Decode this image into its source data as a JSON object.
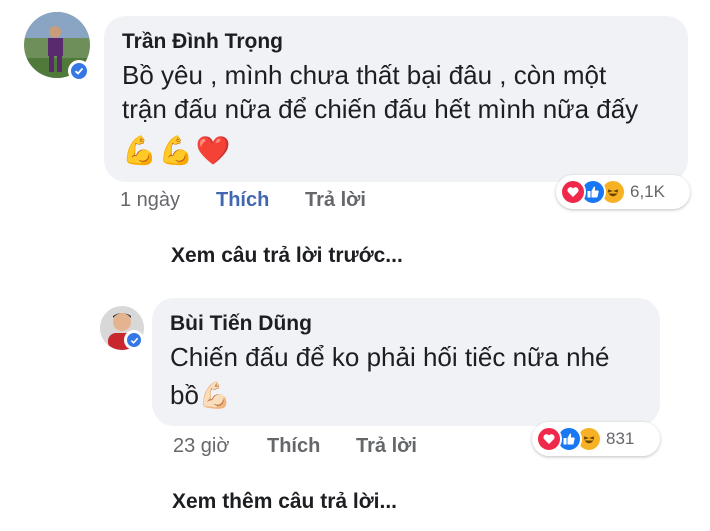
{
  "comments": [
    {
      "author": "Trần Đình Trọng",
      "text_line1": "Bồ yêu , mình chưa thất bại đâu , còn một",
      "text_line2": "trận đấu nữa để chiến đấu hết mình nữa đấy",
      "emoji": "💪💪❤️",
      "time": "1 ngày",
      "like_label": "Thích",
      "reply_label": "Trả lời",
      "reaction_count": "6,1K"
    },
    {
      "author": "Bùi Tiến Dũng",
      "text_line1": "Chiến đấu để ko phải hối tiếc nữa nhé",
      "text_line2": "bồ",
      "emoji": "💪🏻",
      "time": "23 giờ",
      "like_label": "Thích",
      "reply_label": "Trả lời",
      "reaction_count": "831"
    }
  ],
  "view_previous_replies": "Xem câu trả lời trước...",
  "view_more_replies": "Xem thêm câu trả lời...",
  "colors": {
    "bubble": "#f0f2f5",
    "link_blue": "#4267b2",
    "love": "#f0284a",
    "like": "#1877f2",
    "haha": "#f7b125"
  },
  "icons": [
    "verified-badge-icon",
    "love-reaction-icon",
    "like-reaction-icon",
    "haha-reaction-icon"
  ]
}
